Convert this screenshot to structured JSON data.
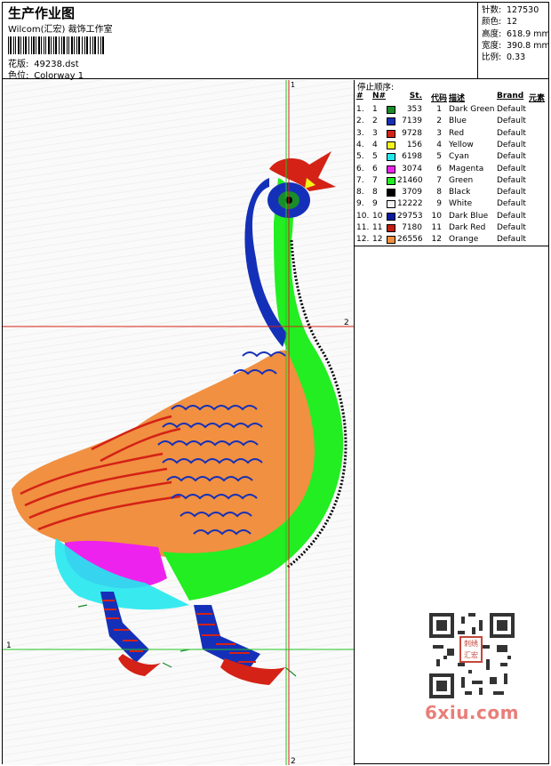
{
  "header": {
    "title": "生产作业图",
    "subtitle": "Wilcom(汇宏) 裁饰工作室",
    "design_label": "花版:",
    "design_value": "49238.dst",
    "colorway_label": "色位:",
    "colorway_value": "Colorway 1"
  },
  "stats": [
    {
      "label": "针数:",
      "value": "127530"
    },
    {
      "label": "颜色:",
      "value": "12"
    },
    {
      "label": "高度:",
      "value": "618.9 mm"
    },
    {
      "label": "宽度:",
      "value": "390.8 mm"
    },
    {
      "label": "比例:",
      "value": "0.33"
    }
  ],
  "guides": {
    "vertical_1": "1",
    "vertical_2": "2",
    "horizontal_1": "1",
    "horizontal_2": "2"
  },
  "sequence": {
    "title": "停止顺序:",
    "headers": {
      "idx": "#",
      "no": "N#",
      "st": "St.",
      "code": "代码",
      "desc": "描述",
      "brand": "Brand",
      "element": "元素"
    },
    "rows": [
      {
        "idx": "1.",
        "no": "1",
        "color": "#1a8c2a",
        "st": "353",
        "code": "1",
        "desc": "Dark Green",
        "brand": "Default"
      },
      {
        "idx": "2.",
        "no": "2",
        "color": "#1530b8",
        "st": "7139",
        "code": "2",
        "desc": "Blue",
        "brand": "Default"
      },
      {
        "idx": "3.",
        "no": "3",
        "color": "#d42216",
        "st": "9728",
        "code": "3",
        "desc": "Red",
        "brand": "Default"
      },
      {
        "idx": "4.",
        "no": "4",
        "color": "#f5f51a",
        "st": "156",
        "code": "4",
        "desc": "Yellow",
        "brand": "Default"
      },
      {
        "idx": "5.",
        "no": "5",
        "color": "#22e8ee",
        "st": "6198",
        "code": "5",
        "desc": "Cyan",
        "brand": "Default"
      },
      {
        "idx": "6.",
        "no": "6",
        "color": "#ee22ee",
        "st": "3074",
        "code": "6",
        "desc": "Magenta",
        "brand": "Default"
      },
      {
        "idx": "7.",
        "no": "7",
        "color": "#22ee22",
        "st": "21460",
        "code": "7",
        "desc": "Green",
        "brand": "Default"
      },
      {
        "idx": "8.",
        "no": "8",
        "color": "#000000",
        "st": "3709",
        "code": "8",
        "desc": "Black",
        "brand": "Default"
      },
      {
        "idx": "9.",
        "no": "9",
        "color": "#f2f2f2",
        "st": "12222",
        "code": "9",
        "desc": "White",
        "brand": "Default"
      },
      {
        "idx": "10.",
        "no": "10",
        "color": "#0a1aa0",
        "st": "29753",
        "code": "10",
        "desc": "Dark Blue",
        "brand": "Default"
      },
      {
        "idx": "11.",
        "no": "11",
        "color": "#c41c10",
        "st": "7180",
        "code": "11",
        "desc": "Dark Red",
        "brand": "Default"
      },
      {
        "idx": "12.",
        "no": "12",
        "color": "#f09040",
        "st": "26556",
        "code": "12",
        "desc": "Orange",
        "brand": "Default"
      }
    ]
  },
  "watermark": {
    "site": "6xiu.com",
    "stamp": "刺绣 汇宏"
  }
}
